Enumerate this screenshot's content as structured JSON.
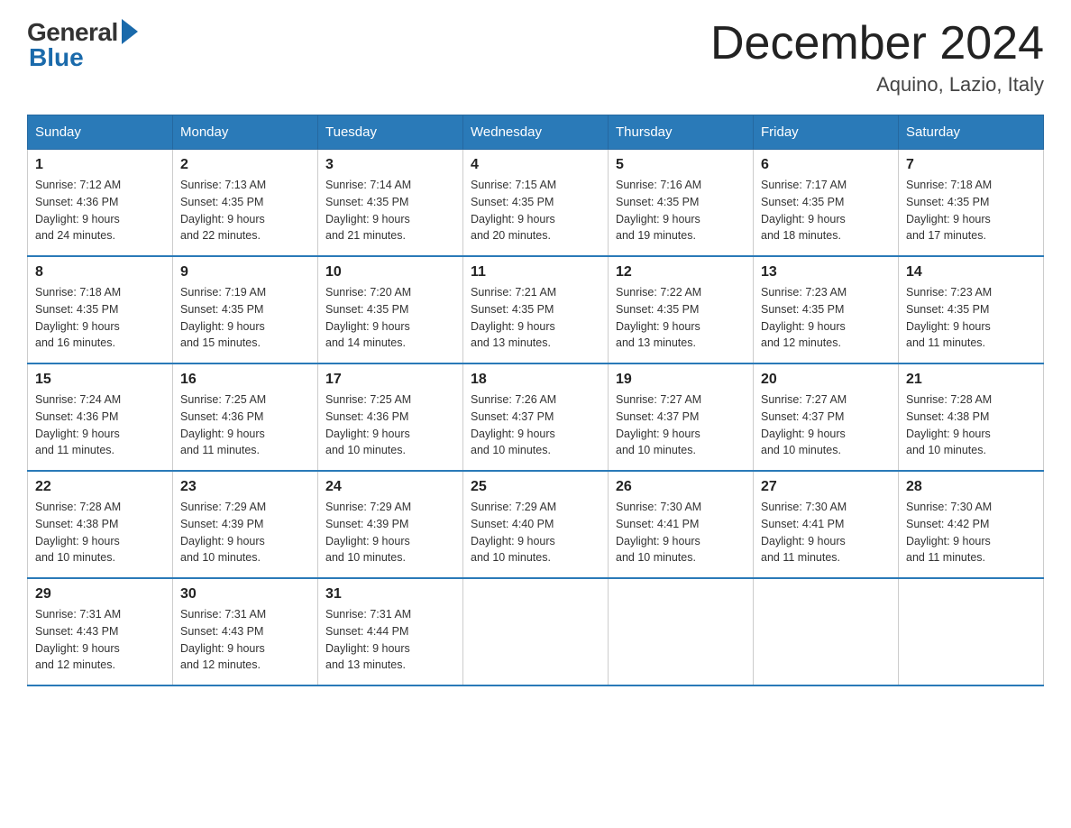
{
  "logo": {
    "general": "General",
    "blue": "Blue"
  },
  "title": "December 2024",
  "subtitle": "Aquino, Lazio, Italy",
  "days_of_week": [
    "Sunday",
    "Monday",
    "Tuesday",
    "Wednesday",
    "Thursday",
    "Friday",
    "Saturday"
  ],
  "weeks": [
    [
      {
        "day": "1",
        "sunrise": "7:12 AM",
        "sunset": "4:36 PM",
        "daylight": "9 hours and 24 minutes."
      },
      {
        "day": "2",
        "sunrise": "7:13 AM",
        "sunset": "4:35 PM",
        "daylight": "9 hours and 22 minutes."
      },
      {
        "day": "3",
        "sunrise": "7:14 AM",
        "sunset": "4:35 PM",
        "daylight": "9 hours and 21 minutes."
      },
      {
        "day": "4",
        "sunrise": "7:15 AM",
        "sunset": "4:35 PM",
        "daylight": "9 hours and 20 minutes."
      },
      {
        "day": "5",
        "sunrise": "7:16 AM",
        "sunset": "4:35 PM",
        "daylight": "9 hours and 19 minutes."
      },
      {
        "day": "6",
        "sunrise": "7:17 AM",
        "sunset": "4:35 PM",
        "daylight": "9 hours and 18 minutes."
      },
      {
        "day": "7",
        "sunrise": "7:18 AM",
        "sunset": "4:35 PM",
        "daylight": "9 hours and 17 minutes."
      }
    ],
    [
      {
        "day": "8",
        "sunrise": "7:18 AM",
        "sunset": "4:35 PM",
        "daylight": "9 hours and 16 minutes."
      },
      {
        "day": "9",
        "sunrise": "7:19 AM",
        "sunset": "4:35 PM",
        "daylight": "9 hours and 15 minutes."
      },
      {
        "day": "10",
        "sunrise": "7:20 AM",
        "sunset": "4:35 PM",
        "daylight": "9 hours and 14 minutes."
      },
      {
        "day": "11",
        "sunrise": "7:21 AM",
        "sunset": "4:35 PM",
        "daylight": "9 hours and 13 minutes."
      },
      {
        "day": "12",
        "sunrise": "7:22 AM",
        "sunset": "4:35 PM",
        "daylight": "9 hours and 13 minutes."
      },
      {
        "day": "13",
        "sunrise": "7:23 AM",
        "sunset": "4:35 PM",
        "daylight": "9 hours and 12 minutes."
      },
      {
        "day": "14",
        "sunrise": "7:23 AM",
        "sunset": "4:35 PM",
        "daylight": "9 hours and 11 minutes."
      }
    ],
    [
      {
        "day": "15",
        "sunrise": "7:24 AM",
        "sunset": "4:36 PM",
        "daylight": "9 hours and 11 minutes."
      },
      {
        "day": "16",
        "sunrise": "7:25 AM",
        "sunset": "4:36 PM",
        "daylight": "9 hours and 11 minutes."
      },
      {
        "day": "17",
        "sunrise": "7:25 AM",
        "sunset": "4:36 PM",
        "daylight": "9 hours and 10 minutes."
      },
      {
        "day": "18",
        "sunrise": "7:26 AM",
        "sunset": "4:37 PM",
        "daylight": "9 hours and 10 minutes."
      },
      {
        "day": "19",
        "sunrise": "7:27 AM",
        "sunset": "4:37 PM",
        "daylight": "9 hours and 10 minutes."
      },
      {
        "day": "20",
        "sunrise": "7:27 AM",
        "sunset": "4:37 PM",
        "daylight": "9 hours and 10 minutes."
      },
      {
        "day": "21",
        "sunrise": "7:28 AM",
        "sunset": "4:38 PM",
        "daylight": "9 hours and 10 minutes."
      }
    ],
    [
      {
        "day": "22",
        "sunrise": "7:28 AM",
        "sunset": "4:38 PM",
        "daylight": "9 hours and 10 minutes."
      },
      {
        "day": "23",
        "sunrise": "7:29 AM",
        "sunset": "4:39 PM",
        "daylight": "9 hours and 10 minutes."
      },
      {
        "day": "24",
        "sunrise": "7:29 AM",
        "sunset": "4:39 PM",
        "daylight": "9 hours and 10 minutes."
      },
      {
        "day": "25",
        "sunrise": "7:29 AM",
        "sunset": "4:40 PM",
        "daylight": "9 hours and 10 minutes."
      },
      {
        "day": "26",
        "sunrise": "7:30 AM",
        "sunset": "4:41 PM",
        "daylight": "9 hours and 10 minutes."
      },
      {
        "day": "27",
        "sunrise": "7:30 AM",
        "sunset": "4:41 PM",
        "daylight": "9 hours and 11 minutes."
      },
      {
        "day": "28",
        "sunrise": "7:30 AM",
        "sunset": "4:42 PM",
        "daylight": "9 hours and 11 minutes."
      }
    ],
    [
      {
        "day": "29",
        "sunrise": "7:31 AM",
        "sunset": "4:43 PM",
        "daylight": "9 hours and 12 minutes."
      },
      {
        "day": "30",
        "sunrise": "7:31 AM",
        "sunset": "4:43 PM",
        "daylight": "9 hours and 12 minutes."
      },
      {
        "day": "31",
        "sunrise": "7:31 AM",
        "sunset": "4:44 PM",
        "daylight": "9 hours and 13 minutes."
      },
      null,
      null,
      null,
      null
    ]
  ],
  "labels": {
    "sunrise": "Sunrise:",
    "sunset": "Sunset:",
    "daylight": "Daylight:"
  }
}
